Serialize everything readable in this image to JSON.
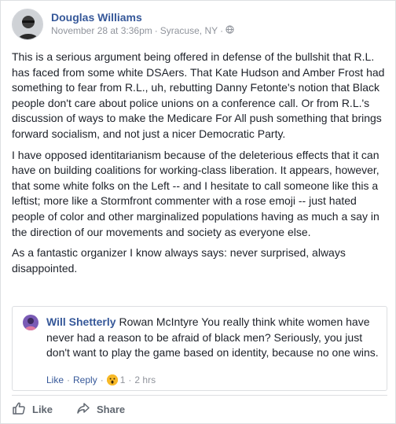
{
  "post": {
    "author": "Douglas Williams",
    "date": "November 28 at 3:36pm",
    "separator": "·",
    "location": "Syracuse, NY",
    "privacy_icon": "globe-icon",
    "paragraphs": [
      "This is a serious argument being offered in defense of the bullshit that R.L. has faced from some white DSAers. That Kate Hudson and Amber Frost had something to fear from R.L., uh, rebutting Danny Fetonte's notion that Black people don't care about police unions on a conference call. Or from R.L.'s discussion of ways to make the Medicare For All push something that brings forward socialism, and not just a nicer Democratic Party.",
      "I have opposed identitarianism because of the deleterious effects that it can have on building coalitions for working-class liberation. It appears, however, that some white folks on the Left -- and I hesitate to call someone like this a leftist; more like a Stormfront commenter with a rose emoji -- just hated people of color and other marginalized populations having as much a say in the direction of our movements and society as everyone else.",
      "As a fantastic organizer I know always says: never surprised, always disappointed."
    ]
  },
  "shared_comment": {
    "author": "Will Shetterly",
    "text": "Rowan McIntyre You really think white women have never had a reason to be afraid of black men? Seriously, you just don't want to play the game based on identity, because no one wins.",
    "like_label": "Like",
    "reply_label": "Reply",
    "sep": "·",
    "reaction_count": "1",
    "time": "2 hrs"
  },
  "actions": {
    "like_label": "Like",
    "share_label": "Share"
  },
  "colors": {
    "link": "#365899",
    "muted": "#90949c",
    "action": "#606770"
  }
}
